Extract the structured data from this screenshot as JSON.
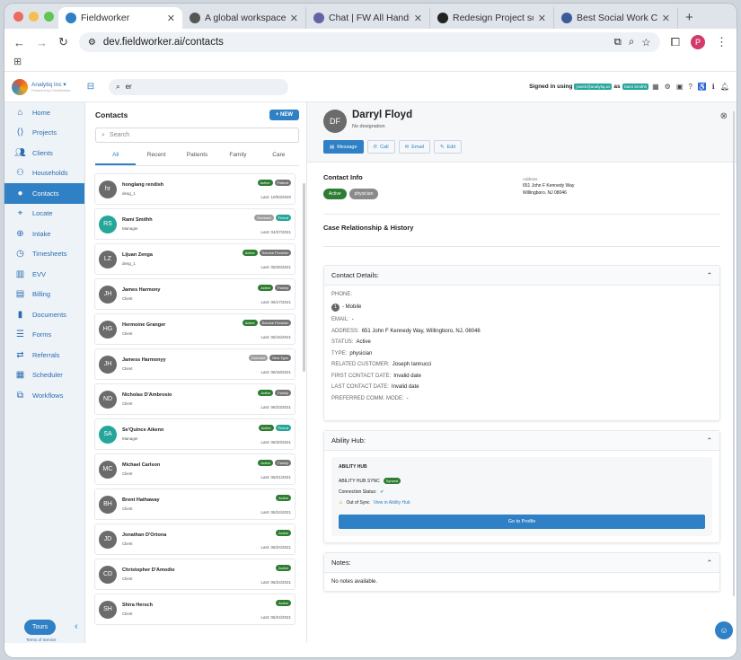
{
  "browser": {
    "tabs": [
      {
        "title": "Fieldworker",
        "active": true
      },
      {
        "title": "A global workspace in la"
      },
      {
        "title": "Chat | FW All Hands | Mi"
      },
      {
        "title": "Redesign Project screen"
      },
      {
        "title": "Best Social Work Care M"
      }
    ],
    "new_tab": "+",
    "url": "dev.fieldworker.ai/contacts",
    "profile": "P"
  },
  "header": {
    "org": "Analytiq Inc ▾",
    "powered": "Powered by FieldWorker",
    "search_value": "er",
    "signed_prefix": "Signed in using",
    "signed_email": "jnaish@analytiq.us",
    "signed_as": "as",
    "signed_user": "Sami Smithh"
  },
  "sidebar": {
    "items": [
      {
        "label": "Home",
        "icon": "home-icon"
      },
      {
        "label": "Projects",
        "icon": "code-icon"
      },
      {
        "label": "Clients",
        "icon": "group-icon"
      },
      {
        "label": "Households",
        "icon": "family-icon"
      },
      {
        "label": "Contacts",
        "icon": "person-icon",
        "active": true
      },
      {
        "label": "Locate",
        "icon": "pin-icon"
      },
      {
        "label": "Intake",
        "icon": "plus-circle-icon"
      },
      {
        "label": "Timesheets",
        "icon": "clock-icon"
      },
      {
        "label": "EVV",
        "icon": "map-icon"
      },
      {
        "label": "Billing",
        "icon": "receipt-icon"
      },
      {
        "label": "Documents",
        "icon": "document-icon"
      },
      {
        "label": "Forms",
        "icon": "list-icon"
      },
      {
        "label": "Referrals",
        "icon": "referral-icon"
      },
      {
        "label": "Scheduler",
        "icon": "calendar-icon"
      },
      {
        "label": "Workflows",
        "icon": "workflow-icon"
      }
    ],
    "tours": "Tours",
    "terms": "Terms of Service"
  },
  "contacts": {
    "title": "Contacts",
    "new_label": "+ NEW",
    "search_placeholder": "Search",
    "tabs": [
      "All",
      "Recent",
      "Patients",
      "Family",
      "Care"
    ],
    "items": [
      {
        "initials": "hr",
        "name": "honglang rendish",
        "role": "desg_1",
        "badges": [
          {
            "t": "Active",
            "c": "#2e7d32"
          },
          {
            "t": "Patient",
            "c": "#757575"
          }
        ],
        "last": "Last: 10/03/2020",
        "avatar": "#6b6b6b"
      },
      {
        "initials": "RS",
        "name": "Rami Smithh",
        "role": "Manager",
        "badges": [
          {
            "t": "Dormant",
            "c": "#9e9e9e"
          },
          {
            "t": "Friend",
            "c": "#26a69a"
          }
        ],
        "last": "Last: 04/27/2021",
        "avatar": "#26a69a"
      },
      {
        "initials": "LZ",
        "name": "Lijuan Zenga",
        "role": "desg_1",
        "badges": [
          {
            "t": "Active",
            "c": "#2e7d32"
          },
          {
            "t": "Service Provider",
            "c": "#757575"
          }
        ],
        "last": "Last: 05/25/2021",
        "avatar": "#6b6b6b"
      },
      {
        "initials": "JH",
        "name": "James Harmony",
        "role": "Client",
        "badges": [
          {
            "t": "Active",
            "c": "#2e7d32"
          },
          {
            "t": "Family",
            "c": "#757575"
          }
        ],
        "last": "Last: 06/17/2021",
        "avatar": "#6b6b6b"
      },
      {
        "initials": "HG",
        "name": "Hermoine Granger",
        "role": "Client",
        "badges": [
          {
            "t": "Active",
            "c": "#2e7d32"
          },
          {
            "t": "Service Provider",
            "c": "#757575"
          }
        ],
        "last": "Last: 06/16/2021",
        "avatar": "#6b6b6b"
      },
      {
        "initials": "JH",
        "name": "Jamess Harmonyy",
        "role": "Client",
        "badges": [
          {
            "t": "Dormant",
            "c": "#9e9e9e"
          },
          {
            "t": "New Type",
            "c": "#757575"
          }
        ],
        "last": "Last: 06/18/2021",
        "avatar": "#6b6b6b"
      },
      {
        "initials": "ND",
        "name": "Nicholas D'Ambrosio",
        "role": "Client",
        "badges": [
          {
            "t": "Active",
            "c": "#2e7d32"
          },
          {
            "t": "Family",
            "c": "#757575"
          }
        ],
        "last": "Last: 06/23/2021",
        "avatar": "#6b6b6b"
      },
      {
        "initials": "SA",
        "name": "Se'Quince Aikenn",
        "role": "Manager",
        "badges": [
          {
            "t": "Active",
            "c": "#2e7d32"
          },
          {
            "t": "Friend",
            "c": "#26a69a"
          }
        ],
        "last": "Last: 06/20/2021",
        "avatar": "#26a69a"
      },
      {
        "initials": "MC",
        "name": "Michael Carlson",
        "role": "Client",
        "badges": [
          {
            "t": "Active",
            "c": "#2e7d32"
          },
          {
            "t": "Family",
            "c": "#757575"
          }
        ],
        "last": "Last: 06/21/2021",
        "avatar": "#6b6b6b"
      },
      {
        "initials": "BH",
        "name": "Brent Hathaway",
        "role": "Client",
        "badges": [
          {
            "t": "Active",
            "c": "#2e7d32"
          }
        ],
        "last": "Last: 06/24/2021",
        "avatar": "#6b6b6b"
      },
      {
        "initials": "JD",
        "name": "Jonathan D'Ortona",
        "role": "Client",
        "badges": [
          {
            "t": "Active",
            "c": "#2e7d32"
          }
        ],
        "last": "Last: 06/24/2021",
        "avatar": "#6b6b6b"
      },
      {
        "initials": "CD",
        "name": "Christopher D'Amodio",
        "role": "Client",
        "badges": [
          {
            "t": "Active",
            "c": "#2e7d32"
          }
        ],
        "last": "Last: 06/24/2021",
        "avatar": "#6b6b6b"
      },
      {
        "initials": "SH",
        "name": "Shira Hersch",
        "role": "Client",
        "badges": [
          {
            "t": "Active",
            "c": "#2e7d32"
          }
        ],
        "last": "Last: 06/24/2021",
        "avatar": "#6b6b6b"
      }
    ]
  },
  "detail": {
    "initials": "DF",
    "name": "Darryl Floyd",
    "designation": "No designation",
    "actions": {
      "message": "Message",
      "call": "Call",
      "email": "Email",
      "edit": "Edit"
    },
    "contact_info_title": "Contact Info",
    "status_pill": "Active",
    "type_pill": "physician",
    "address_label": "Address",
    "address_line1": "651 John F Kennedy Way",
    "address_line2": "Willingboro, NJ 08046",
    "case_title": "Case Relationship & History",
    "contact_details": {
      "title": "Contact Details:",
      "phone_label": "PHONE:",
      "phone_index": "1",
      "phone_value": "- Mobile",
      "email_label": "EMAIL:",
      "email_value": "-",
      "address_label": "ADDRESS:",
      "address_value": "651 John F Kennedy Way, Willingboro, NJ, 08046",
      "status_label": "STATUS:",
      "status_value": "Active",
      "type_label": "TYPE:",
      "type_value": "physician",
      "related_label": "RELATED CUSTOMER:",
      "related_value": "Joseph Iannucci",
      "first_label": "FIRST CONTACT DATE:",
      "first_value": "Invalid date",
      "last_label": "LAST CONTACT DATE:",
      "last_value": "Invalid date",
      "comm_label": "PREFERRED COMM. MODE:",
      "comm_value": "-"
    },
    "ability": {
      "title": "Ability Hub:",
      "inner_title": "ABILITY HUB",
      "sync_label": "ABILITY HUB SYNC",
      "sync_badge": "Synced",
      "conn_label": "Connection Status:",
      "out_label": "Out of Sync",
      "view_link": "View in Ability Hub",
      "button": "Go to Profile"
    },
    "notes": {
      "title": "Notes:",
      "empty": "No notes available."
    }
  }
}
